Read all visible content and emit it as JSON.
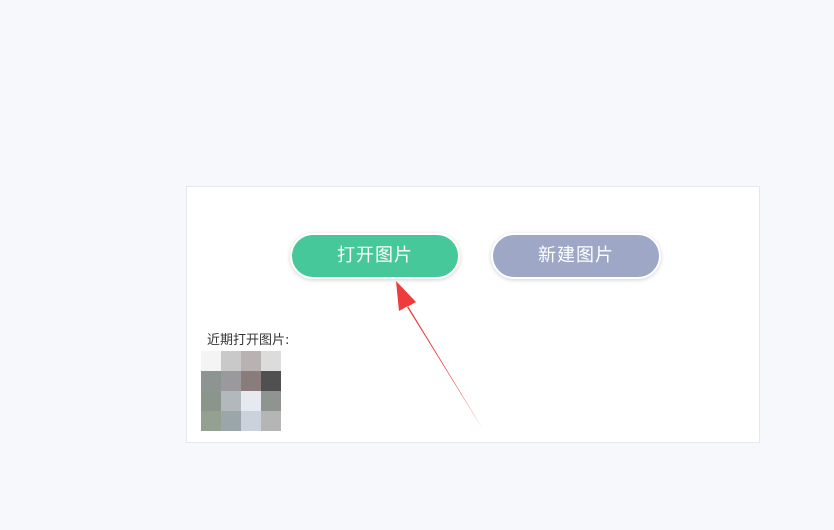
{
  "panel": {
    "open_button_label": "打开图片",
    "new_button_label": "新建图片",
    "recent_label": "近期打开图片:",
    "colors": {
      "open_button": "#47c89a",
      "new_button": "#9ea8c6",
      "arrow": "#ee3b3b"
    }
  }
}
